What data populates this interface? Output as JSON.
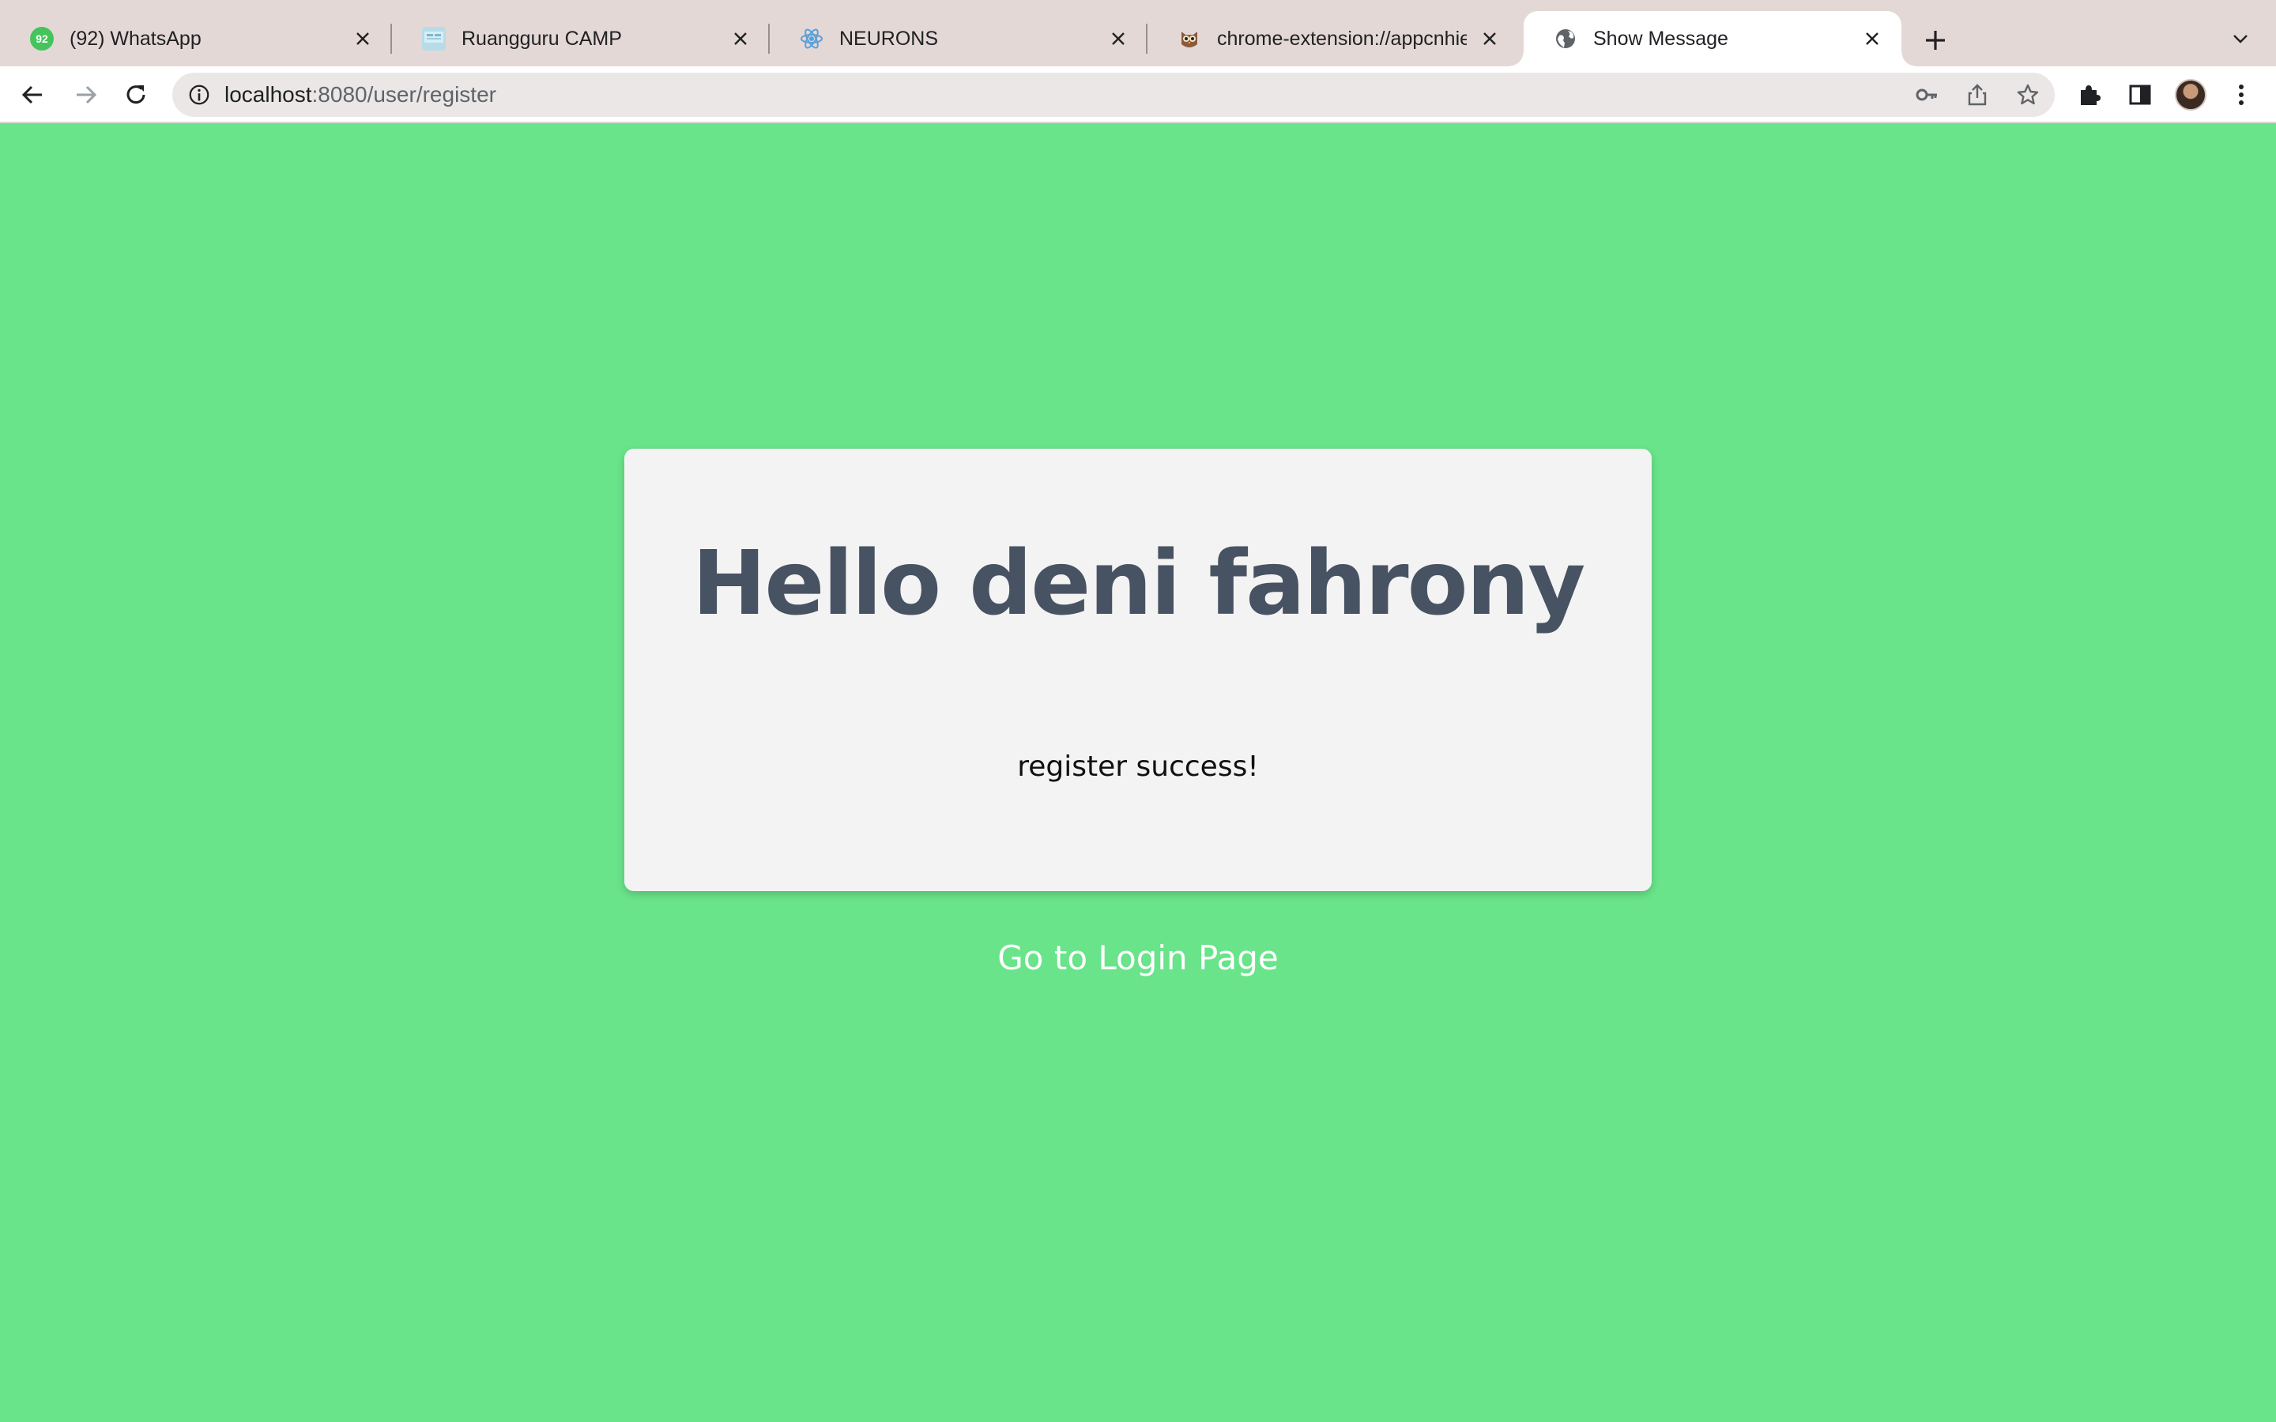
{
  "browser": {
    "tabs": [
      {
        "title": "(92) WhatsApp",
        "badge": "92",
        "icon": "whatsapp-icon",
        "active": false
      },
      {
        "title": "Ruangguru CAMP",
        "icon": "ruangguru-camp-icon",
        "active": false
      },
      {
        "title": "NEURONS",
        "icon": "neurons-icon",
        "active": false
      },
      {
        "title": "chrome-extension://appcnhiefc",
        "icon": "owl-extension-icon",
        "active": false
      },
      {
        "title": "Show Message",
        "icon": "globe-icon",
        "active": true
      }
    ],
    "address_bar": {
      "host": "localhost",
      "path": ":8080/user/register"
    }
  },
  "page": {
    "greeting": "Hello deni fahrony",
    "message": "register success!",
    "login_link": "Go to Login Page"
  },
  "colors": {
    "page_background": "#69e48a",
    "card_background": "#f3f3f3",
    "heading_text": "#475262",
    "link_text": "#ffffff"
  }
}
